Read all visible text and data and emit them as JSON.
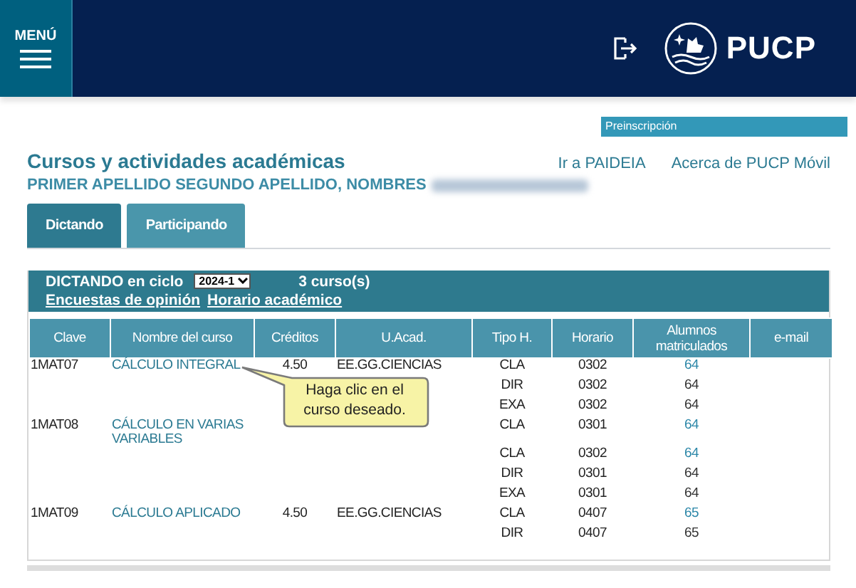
{
  "header": {
    "menu_label": "MENÚ",
    "logo_text": "PUCP"
  },
  "preinscription_link": "Preinscripción",
  "title": "Cursos y actividades académicas",
  "links": [
    "Ir a PAIDEIA",
    "Acerca de PUCP Móvil"
  ],
  "user_name": "PRIMER APELLIDO SEGUNDO APELLIDO, NOMBRES",
  "tabs": [
    {
      "label": "Dictando",
      "selected": true
    },
    {
      "label": "Participando",
      "selected": false
    }
  ],
  "panel": {
    "cycle_label": "DICTANDO en ciclo",
    "cycle_value": "2024-1",
    "course_count": "3 curso(s)",
    "links": [
      "Encuestas de opinión",
      "Horario académico"
    ]
  },
  "table": {
    "columns": [
      "Clave",
      "Nombre del curso",
      "Créditos",
      "U.Acad.",
      "Tipo H.",
      "Horario",
      "Alumnos matriculados",
      "e-mail"
    ],
    "rows": [
      {
        "code": "1MAT07",
        "course": "CÁLCULO INTEGRAL",
        "credits": "4.50",
        "unit": "EE.GG.CIENCIAS",
        "type": "CLA",
        "schedule": "0302",
        "students": "64",
        "linked": true
      },
      {
        "type": "DIR",
        "schedule": "0302",
        "students": "64",
        "linked": false
      },
      {
        "type": "EXA",
        "schedule": "0302",
        "students": "64",
        "linked": false
      },
      {
        "code": "1MAT08",
        "course": "CÁLCULO EN VARIAS VARIABLES",
        "type": "CLA",
        "schedule": "0301",
        "students": "64",
        "linked": true
      },
      {
        "type": "CLA",
        "schedule": "0302",
        "students": "64",
        "linked": true
      },
      {
        "type": "DIR",
        "schedule": "0301",
        "students": "64",
        "linked": false
      },
      {
        "type": "EXA",
        "schedule": "0301",
        "students": "64",
        "linked": false
      },
      {
        "code": "1MAT09",
        "course": "CÁLCULO APLICADO",
        "credits": "4.50",
        "unit": "EE.GG.CIENCIAS",
        "type": "CLA",
        "schedule": "0407",
        "students": "65",
        "linked": true
      },
      {
        "type": "DIR",
        "schedule": "0407",
        "students": "65",
        "linked": false
      }
    ]
  },
  "tooltip": "Haga clic en el curso deseado."
}
